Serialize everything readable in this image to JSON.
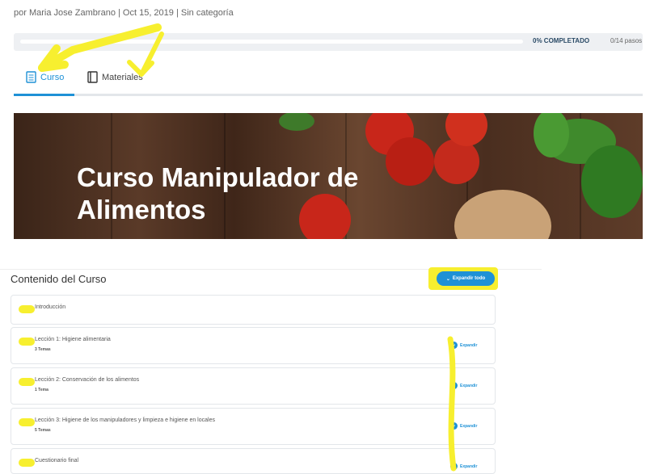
{
  "meta": {
    "byline": "por Maria Jose Zambrano | Oct 15, 2019 | Sin categoría"
  },
  "progress": {
    "percent_label": "0% COMPLETADO",
    "steps_label": "0/14 pasos",
    "fraction": 0.0
  },
  "tabs": [
    {
      "label": "Curso",
      "icon": "document-icon",
      "active": true
    },
    {
      "label": "Materiales",
      "icon": "book-icon",
      "active": false
    }
  ],
  "banner": {
    "title": "Curso Manipulador de Alimentos"
  },
  "content": {
    "title": "Contenido del Curso",
    "expand_all_label": "Expandir todo",
    "lessons": [
      {
        "title": "Introducción",
        "subtitle": "",
        "expand": ""
      },
      {
        "title": "Lección 1: Higiene alimentaria",
        "subtitle": "3 Temas",
        "expand": "Expandir"
      },
      {
        "title": "Lección 2: Conservación de los alimentos",
        "subtitle": "1 Tema",
        "expand": "Expandir"
      },
      {
        "title": "Lección 3: Higiene de los manipuladores y limpieza e higiene en locales",
        "subtitle": "5 Temas",
        "expand": "Expandir"
      },
      {
        "title": "Cuestionario final",
        "subtitle": "",
        "expand": "Expandir"
      }
    ]
  },
  "colors": {
    "accent": "#1e91d6",
    "highlight": "#f7ef2f"
  }
}
